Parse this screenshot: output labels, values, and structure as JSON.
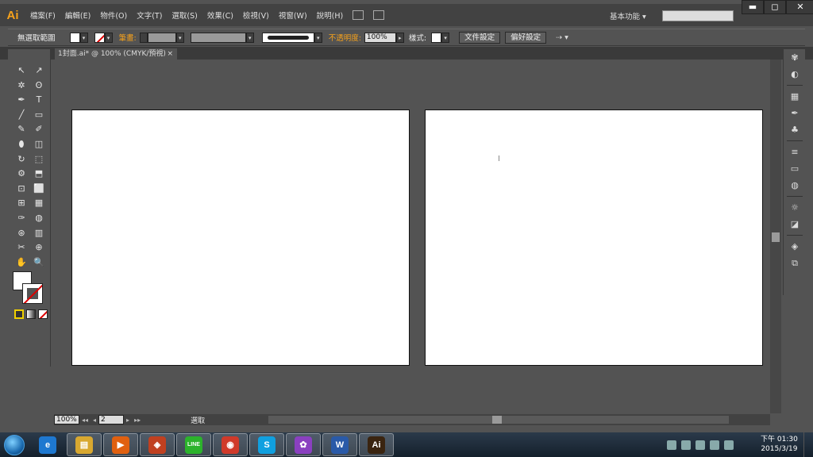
{
  "menubar": {
    "logo": "Ai",
    "items": [
      "檔案(F)",
      "編輯(E)",
      "物件(O)",
      "文字(T)",
      "選取(S)",
      "效果(C)",
      "檢視(V)",
      "視窗(W)",
      "說明(H)"
    ],
    "workspace": "基本功能",
    "window_buttons": [
      "▬",
      "◻",
      "✕"
    ]
  },
  "controlbar": {
    "selection_label": "無選取範圍",
    "stroke_label": "筆畫:",
    "opacity_label": "不透明度:",
    "opacity_value": "100%",
    "style_label": "樣式:",
    "doc_setup": "文件設定",
    "preferences": "偏好設定"
  },
  "document_tab": {
    "title": "1封面.ai* @ 100% (CMYK/預視)",
    "close": "×"
  },
  "tools": [
    "↖",
    "↗",
    "✲",
    "ʘ",
    "✒",
    "T",
    "╱",
    "▭",
    "✎",
    "✐",
    "⬮",
    "◫",
    "↻",
    "⬚",
    "⚙",
    "⬒",
    "⊡",
    "⬜",
    "⊞",
    "▦",
    "✑",
    "◍",
    "⊛",
    "▥",
    "✂",
    "⊕",
    "✋",
    "🔍"
  ],
  "status": {
    "zoom": "100%",
    "nav_first": "◂◂",
    "nav_prev": "◂",
    "page": "2",
    "nav_next": "▸",
    "nav_last": "▸▸",
    "tool_status": "選取"
  },
  "right_panel_icons": [
    "palette-icon",
    "color-guide-icon",
    "swatches-icon",
    "brushes-icon",
    "symbols-icon",
    "stroke-icon",
    "gradient-icon",
    "transparency-icon",
    "appearance-icon",
    "graphic-styles-icon",
    "layers-icon",
    "artboards-icon"
  ],
  "taskbar": {
    "apps": [
      {
        "name": "ie",
        "glyph": "e",
        "color": "#1e78d0"
      },
      {
        "name": "explorer",
        "glyph": "▤",
        "color": "#d8a830"
      },
      {
        "name": "media",
        "glyph": "▶",
        "color": "#e06010"
      },
      {
        "name": "box",
        "glyph": "◈",
        "color": "#c04020"
      },
      {
        "name": "line",
        "glyph": "LINE",
        "color": "#2cb32c"
      },
      {
        "name": "chrome",
        "glyph": "◉",
        "color": "#d03a2a"
      },
      {
        "name": "skype",
        "glyph": "S",
        "color": "#10a0e0"
      },
      {
        "name": "picasa",
        "glyph": "✿",
        "color": "#8a40c0"
      },
      {
        "name": "word",
        "glyph": "W",
        "color": "#2a5aa8"
      },
      {
        "name": "illustrator",
        "glyph": "Ai",
        "color": "#3a2410"
      }
    ],
    "clock_time": "下午 01:30",
    "clock_date": "2015/3/19"
  },
  "colors": {
    "accent": "#f7a21b",
    "panel": "#535353",
    "artboard": "#ffffff"
  }
}
